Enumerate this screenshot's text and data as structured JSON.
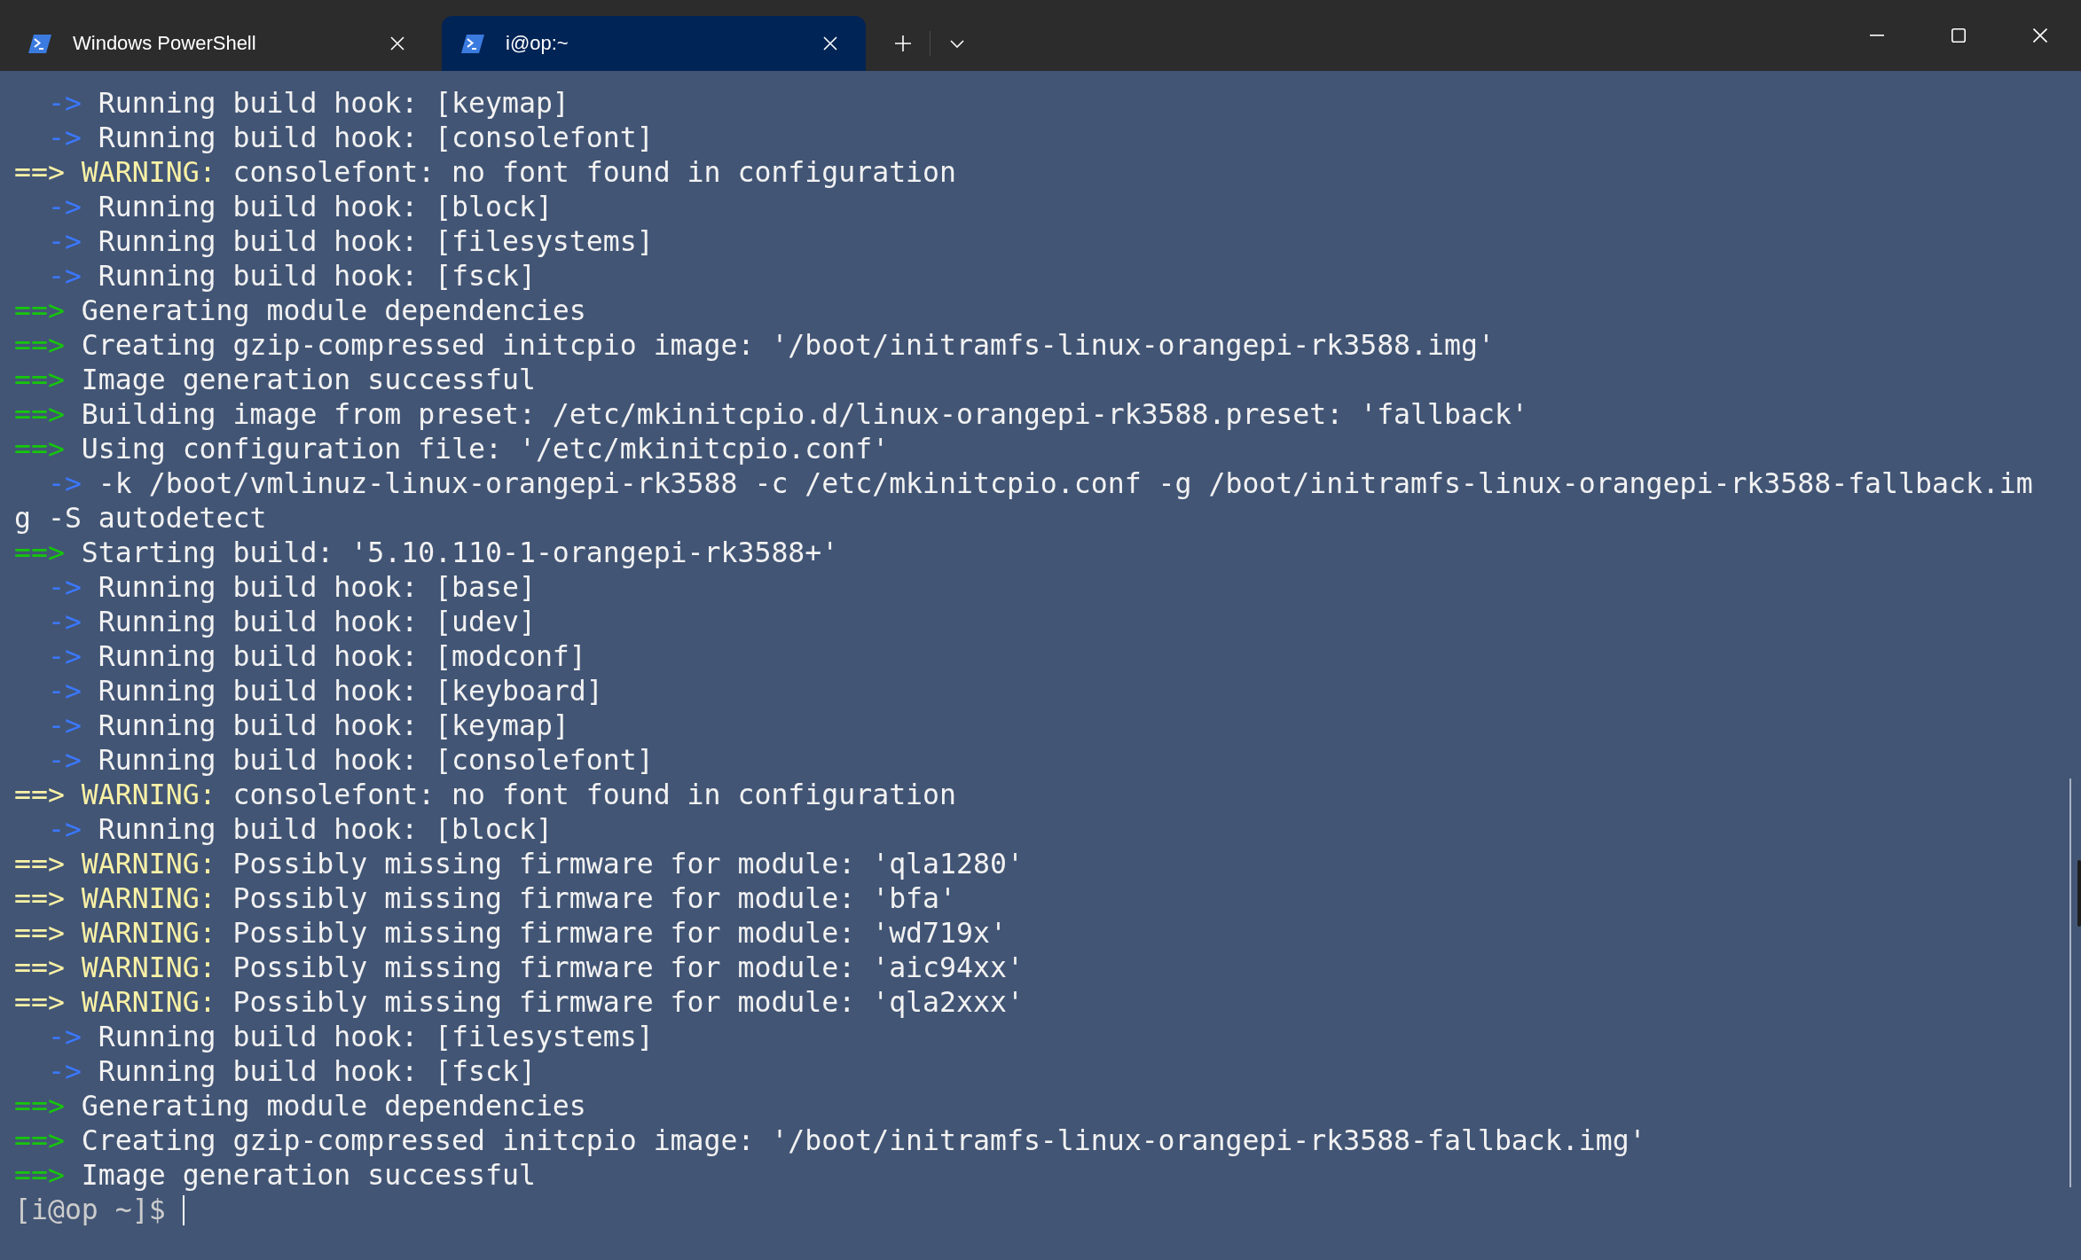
{
  "window": {
    "tabs": [
      {
        "label": "Windows PowerShell",
        "selected": false
      },
      {
        "label": "i@op:~",
        "selected": true
      }
    ]
  },
  "terminal": {
    "lines": [
      {
        "kind": "hook",
        "marker": "->",
        "text": "Running build hook: [keymap]"
      },
      {
        "kind": "hook",
        "marker": "->",
        "text": "Running build hook: [consolefont]"
      },
      {
        "kind": "warning",
        "marker": "==>",
        "label": "WARNING:",
        "text": "consolefont: no font found in configuration"
      },
      {
        "kind": "hook",
        "marker": "->",
        "text": "Running build hook: [block]"
      },
      {
        "kind": "hook",
        "marker": "->",
        "text": "Running build hook: [filesystems]"
      },
      {
        "kind": "hook",
        "marker": "->",
        "text": "Running build hook: [fsck]"
      },
      {
        "kind": "step",
        "marker": "==>",
        "text": "Generating module dependencies"
      },
      {
        "kind": "step",
        "marker": "==>",
        "text": "Creating gzip-compressed initcpio image: '/boot/initramfs-linux-orangepi-rk3588.img'"
      },
      {
        "kind": "step",
        "marker": "==>",
        "text": "Image generation successful"
      },
      {
        "kind": "step",
        "marker": "==>",
        "text": "Building image from preset: /etc/mkinitcpio.d/linux-orangepi-rk3588.preset: 'fallback'"
      },
      {
        "kind": "step",
        "marker": "==>",
        "text": "Using configuration file: '/etc/mkinitcpio.conf'"
      },
      {
        "kind": "hook",
        "marker": "->",
        "text": "-k /boot/vmlinuz-linux-orangepi-rk3588 -c /etc/mkinitcpio.conf -g /boot/initramfs-linux-orangepi-rk3588-fallback.im"
      },
      {
        "kind": "plain",
        "text": "g -S autodetect"
      },
      {
        "kind": "step",
        "marker": "==>",
        "text": "Starting build: '5.10.110-1-orangepi-rk3588+'"
      },
      {
        "kind": "hook",
        "marker": "->",
        "text": "Running build hook: [base]"
      },
      {
        "kind": "hook",
        "marker": "->",
        "text": "Running build hook: [udev]"
      },
      {
        "kind": "hook",
        "marker": "->",
        "text": "Running build hook: [modconf]"
      },
      {
        "kind": "hook",
        "marker": "->",
        "text": "Running build hook: [keyboard]"
      },
      {
        "kind": "hook",
        "marker": "->",
        "text": "Running build hook: [keymap]"
      },
      {
        "kind": "hook",
        "marker": "->",
        "text": "Running build hook: [consolefont]"
      },
      {
        "kind": "warning",
        "marker": "==>",
        "label": "WARNING:",
        "text": "consolefont: no font found in configuration"
      },
      {
        "kind": "hook",
        "marker": "->",
        "text": "Running build hook: [block]"
      },
      {
        "kind": "warning",
        "marker": "==>",
        "label": "WARNING:",
        "text": "Possibly missing firmware for module: 'qla1280'"
      },
      {
        "kind": "warning",
        "marker": "==>",
        "label": "WARNING:",
        "text": "Possibly missing firmware for module: 'bfa'"
      },
      {
        "kind": "warning",
        "marker": "==>",
        "label": "WARNING:",
        "text": "Possibly missing firmware for module: 'wd719x'"
      },
      {
        "kind": "warning",
        "marker": "==>",
        "label": "WARNING:",
        "text": "Possibly missing firmware for module: 'aic94xx'"
      },
      {
        "kind": "warning",
        "marker": "==>",
        "label": "WARNING:",
        "text": "Possibly missing firmware for module: 'qla2xxx'"
      },
      {
        "kind": "hook",
        "marker": "->",
        "text": "Running build hook: [filesystems]"
      },
      {
        "kind": "hook",
        "marker": "->",
        "text": "Running build hook: [fsck]"
      },
      {
        "kind": "step",
        "marker": "==>",
        "text": "Generating module dependencies"
      },
      {
        "kind": "step",
        "marker": "==>",
        "text": "Creating gzip-compressed initcpio image: '/boot/initramfs-linux-orangepi-rk3588-fallback.img'"
      },
      {
        "kind": "step",
        "marker": "==>",
        "text": "Image generation successful"
      },
      {
        "kind": "prompt",
        "text": "[i@op ~]$",
        "cursor": true
      }
    ]
  }
}
